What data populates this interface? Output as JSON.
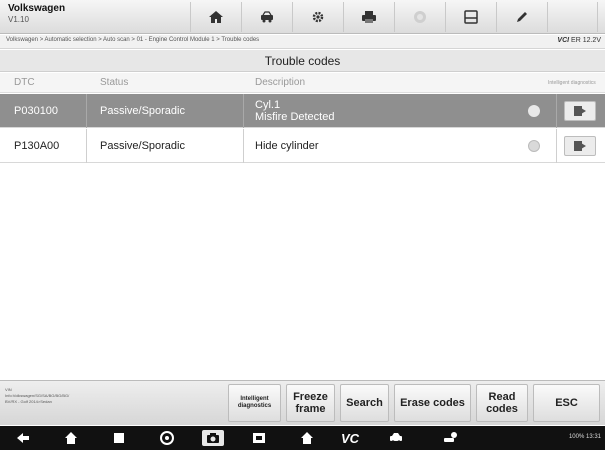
{
  "header": {
    "title": "Volkswagen",
    "version": "V1.10"
  },
  "toolbar": [
    "home-icon",
    "vehicle-swap-icon",
    "settings-icon",
    "print-icon",
    "help-icon",
    "save-icon",
    "edit-icon"
  ],
  "breadcrumb": "Volkswagen > Automatic selection > Auto scan > 01 - Engine Control Module 1 > Trouble codes",
  "vci": {
    "brand": "VCI",
    "value": "ER 12.2V"
  },
  "section_title": "Trouble codes",
  "table": {
    "headers": {
      "dtc": "DTC",
      "status": "Status",
      "description": "Description",
      "intelligent": "Intelligent diagnostics"
    },
    "rows": [
      {
        "dtc": "P030100",
        "status": "Passive/Sporadic",
        "desc_line1": "Cyl.1",
        "desc_line2": "Misfire Detected"
      },
      {
        "dtc": "P130A00",
        "status": "Passive/Sporadic",
        "desc_line1": "Hide cylinder",
        "desc_line2": ""
      }
    ]
  },
  "vehicle_info": {
    "line1": "VIN",
    "line2": "Info:Volkswagen/SG/SA/BG/BG/BG/",
    "line3": "BV/RX - Golf 2014>Sedan"
  },
  "buttons": {
    "intelligent": "Intelligent diagnostics",
    "freeze": "Freeze frame",
    "search": "Search",
    "erase": "Erase codes",
    "read": "Read codes",
    "esc": "ESC"
  },
  "statusbar": {
    "right": "100% 13:31"
  }
}
